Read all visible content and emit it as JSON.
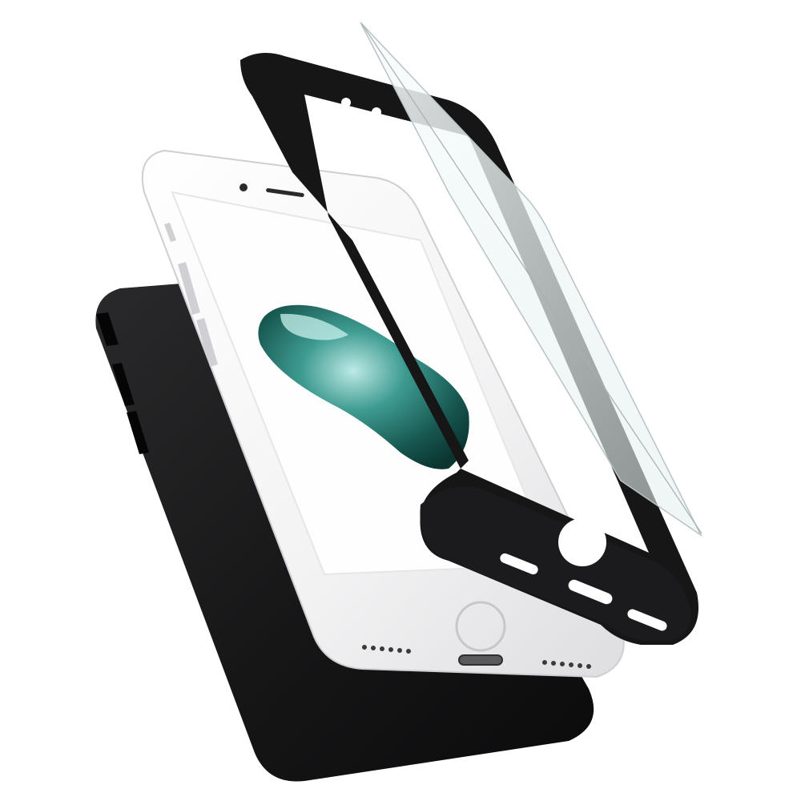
{
  "scene": {
    "description_visible_text": "",
    "background": "#ffffff",
    "colors": {
      "case_black": "#1c1c1e",
      "case_edge": "#0a0a0b",
      "phone_silver": "#f4f4f5",
      "phone_edge": "#d9d9dc",
      "screen_white": "#fefefe",
      "wallpaper_teal": "#1f6f67",
      "wallpaper_highlight": "#8fd6cf",
      "glass_tint": "#e9f3f2"
    },
    "icons": [
      "back-case",
      "iphone",
      "front-bumper",
      "tempered-glass-protector",
      "home-button",
      "lightning-port",
      "speaker-grille"
    ]
  }
}
